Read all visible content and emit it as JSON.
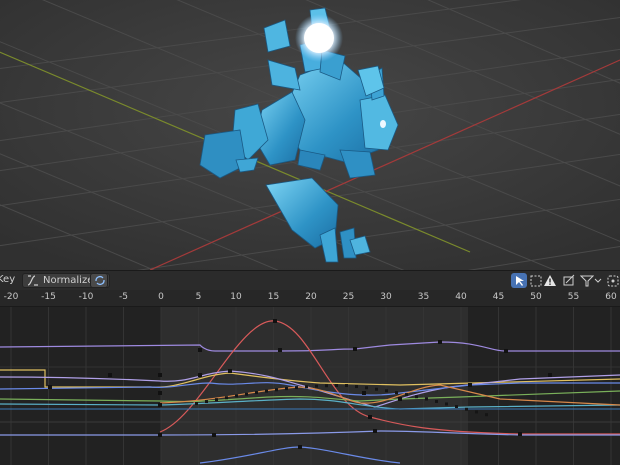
{
  "toolbar": {
    "key_label": "Key",
    "normalize_label": "Normalize",
    "icons": [
      "normalize-icon",
      "refresh-icon",
      "select-cursor-icon",
      "snap-icon",
      "warning-icon",
      "overlay-icon",
      "filter-icon",
      "chevron-down-icon",
      "lasso-icon"
    ]
  },
  "timeline": {
    "ticks": [
      "-20",
      "-15",
      "-10",
      "-5",
      "0",
      "5",
      "10",
      "15",
      "20",
      "25",
      "30",
      "35",
      "40",
      "45",
      "50",
      "55",
      "60"
    ],
    "scene_start": 0,
    "scene_end": 41
  },
  "colors": {
    "accent": "#4772b3",
    "grid_x": "#9a3b3b",
    "grid_y": "#6b8a2a",
    "crystal": "#3aa0d0",
    "curve_red": "#d85a5a",
    "curve_purple": "#9e8ae0",
    "curve_blue": "#6a8ae8",
    "curve_yellow": "#e0c060",
    "curve_orange": "#d8894a",
    "curve_cyan": "#5ab0c8",
    "curve_green": "#7ab05a"
  }
}
